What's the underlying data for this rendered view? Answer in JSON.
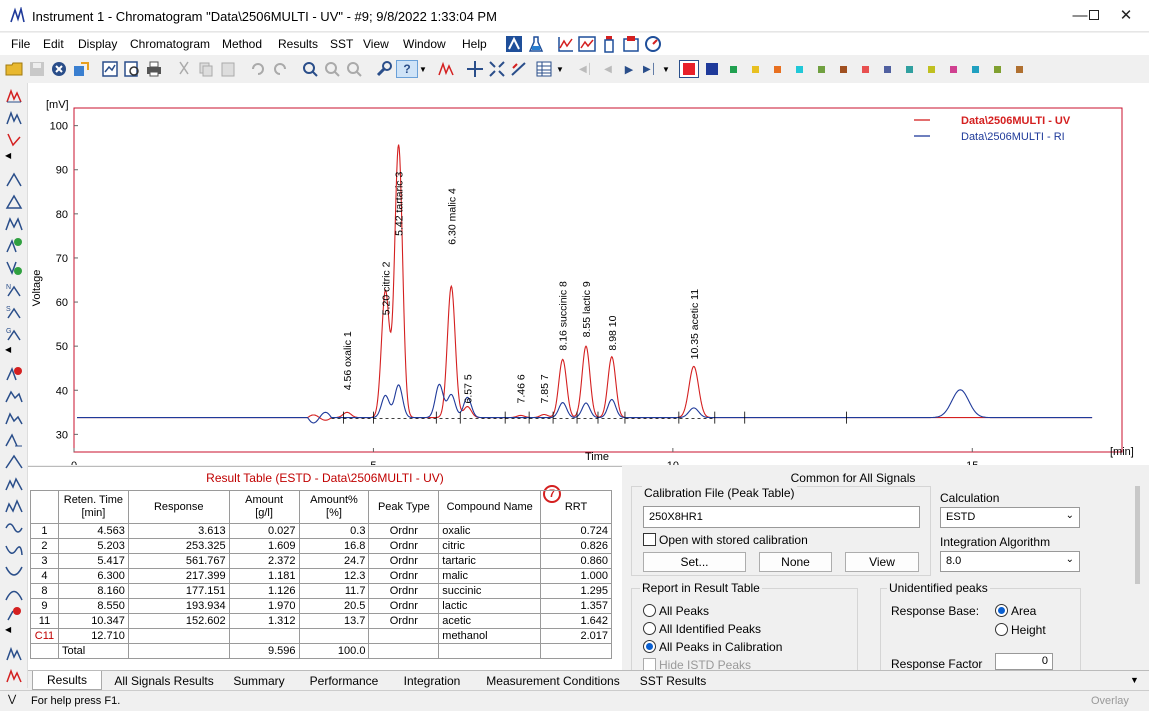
{
  "window": {
    "title": "Instrument 1 - Chromatogram \"Data\\2506MULTI - UV\" - #9;   9/8/2022   1:33:04 PM"
  },
  "menu": [
    "File",
    "Edit",
    "Display",
    "Chromatogram",
    "Method",
    "Results",
    "SST",
    "View",
    "Window",
    "Help"
  ],
  "plot": {
    "y_unit": "[mV]",
    "ylabel": "Voltage",
    "xlabel": "Time",
    "x_unit": "[min]",
    "yticks": [
      "100",
      "90",
      "80",
      "70",
      "60",
      "50",
      "40",
      "30"
    ],
    "xticks": [
      "0",
      "5",
      "10",
      "15"
    ],
    "legend": [
      "Data\\2506MULTI - UV",
      "Data\\2506MULTI - RI"
    ],
    "peak_labels": [
      "4.56 oxalic  1",
      "5.20 citric  2",
      "5.42 tartaric  3",
      "6.30 malic  4",
      "6.57  5",
      "7.46  6",
      "7.85  7",
      "8.16 succinic  8",
      "8.55 lactic  9",
      "8.98  10",
      "10.35 acetic  11"
    ]
  },
  "chart_data": {
    "type": "line",
    "title": "",
    "xlabel": "Time",
    "ylabel": "Voltage",
    "x_unit": "[min]",
    "y_unit": "[mV]",
    "xlim": [
      0,
      17.5
    ],
    "ylim": [
      26,
      104
    ],
    "series": [
      {
        "name": "Data\\2506MULTI - UV",
        "color": "#d42020",
        "peaks": [
          [
            4.56,
            1.2
          ],
          [
            5.2,
            28.7
          ],
          [
            5.42,
            61.8
          ],
          [
            6.3,
            29.8
          ],
          [
            6.57,
            2.5
          ],
          [
            7.46,
            0.5
          ],
          [
            7.85,
            0.7
          ],
          [
            8.16,
            13.2
          ],
          [
            8.55,
            16.2
          ],
          [
            8.98,
            13.8
          ],
          [
            10.35,
            11.6
          ]
        ]
      },
      {
        "name": "Data\\2506MULTI - RI",
        "color": "#1f3a9a",
        "peaks": [
          [
            5.2,
            5.0
          ],
          [
            5.42,
            7.4
          ],
          [
            6.1,
            7.5
          ],
          [
            6.3,
            5.2
          ],
          [
            6.57,
            4.6
          ],
          [
            8.16,
            3.4
          ],
          [
            8.55,
            3.3
          ],
          [
            8.98,
            4.1
          ],
          [
            10.35,
            2.2
          ],
          [
            14.8,
            6.3
          ]
        ]
      }
    ],
    "baseline": 33.8
  },
  "result_table": {
    "title": "Result Table (ESTD - Data\\2506MULTI - UV)",
    "badge": "7",
    "headers": [
      "Reten. Time\n[min]",
      "Response",
      "Amount\n[g/l]",
      "Amount%\n[%]",
      "Peak Type",
      "Compound Name",
      "RRT"
    ],
    "rows": [
      [
        "1",
        "4.563",
        "3.613",
        "0.027",
        "0.3",
        "Ordnr",
        "oxalic",
        "0.724"
      ],
      [
        "2",
        "5.203",
        "253.325",
        "1.609",
        "16.8",
        "Ordnr",
        "citric",
        "0.826"
      ],
      [
        "3",
        "5.417",
        "561.767",
        "2.372",
        "24.7",
        "Ordnr",
        "tartaric",
        "0.860"
      ],
      [
        "4",
        "6.300",
        "217.399",
        "1.181",
        "12.3",
        "Ordnr",
        "malic",
        "1.000"
      ],
      [
        "8",
        "8.160",
        "177.151",
        "1.126",
        "11.7",
        "Ordnr",
        "succinic",
        "1.295"
      ],
      [
        "9",
        "8.550",
        "193.934",
        "1.970",
        "20.5",
        "Ordnr",
        "lactic",
        "1.357"
      ],
      [
        "11",
        "10.347",
        "152.602",
        "1.312",
        "13.7",
        "Ordnr",
        "acetic",
        "1.642"
      ],
      [
        "C11",
        "12.710",
        "",
        "",
        "",
        "",
        "methanol",
        "2.017"
      ],
      [
        "",
        "Total",
        "",
        "9.596",
        "100.0",
        "",
        "",
        ""
      ]
    ]
  },
  "common": {
    "title": "Common for All Signals",
    "cal_label": "Calibration File (Peak Table)",
    "cal_value": "250X8HR1",
    "open_stored": "Open with stored calibration",
    "btn_set": "Set...",
    "btn_none": "None",
    "btn_view": "View",
    "calc_label": "Calculation",
    "calc_value": "ESTD",
    "integ_label": "Integration Algorithm",
    "integ_value": "8.0",
    "report_label": "Report in Result Table",
    "report_opts": [
      "All Peaks",
      "All Identified Peaks",
      "All Peaks in Calibration",
      "Hide ISTD Peaks"
    ],
    "unid_label": "Unidentified peaks",
    "resp_base": "Response Base:",
    "opt_area": "Area",
    "opt_height": "Height",
    "resp_factor": "Response Factor",
    "resp_factor_value": "0"
  },
  "tabs": [
    "Results",
    "All Signals Results",
    "Summary",
    "Performance",
    "Integration",
    "Measurement Conditions",
    "SST Results"
  ],
  "status": {
    "help": "For help press F1.",
    "overlay": "Overlay"
  }
}
